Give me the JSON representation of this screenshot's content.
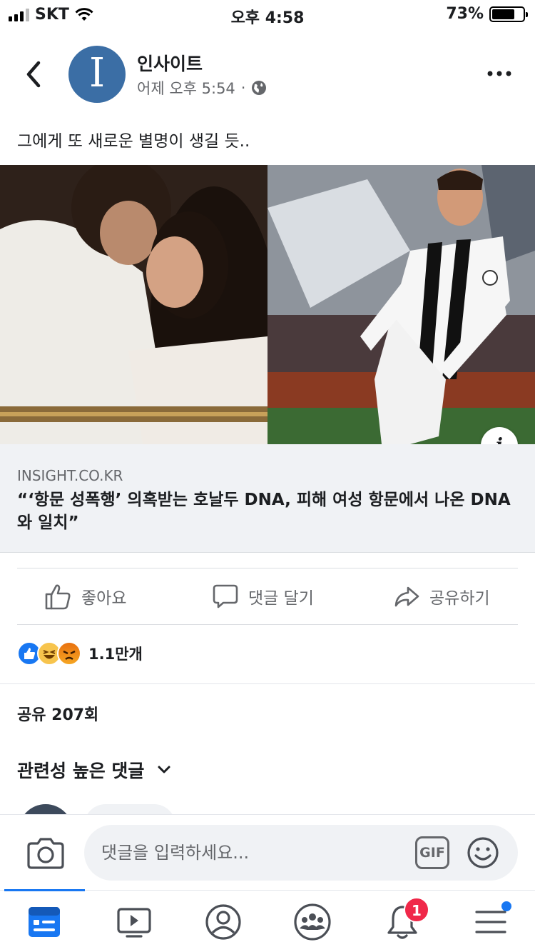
{
  "status_bar": {
    "carrier": "SKT",
    "time": "오후 4:58",
    "battery_percent": "73%",
    "battery_level": 0.73
  },
  "header": {
    "page_name": "인사이트",
    "avatar_letter": "I",
    "timestamp": "어제 오후 5:54",
    "separator": "·",
    "privacy_icon": "globe-icon"
  },
  "post": {
    "text": "그에게 또 새로운 별명이 생길 듯.."
  },
  "link": {
    "info_label": "i",
    "domain": "INSIGHT.CO.KR",
    "title": "“‘항문 성폭행’ 의혹받는 호날두 DNA, 피해 여성 항문에서 나온 DNA와 일치”"
  },
  "actions": {
    "like": "좋아요",
    "comment": "댓글 달기",
    "share": "공유하기"
  },
  "reactions": {
    "types": [
      "like",
      "haha",
      "angry"
    ],
    "count": "1.1만개"
  },
  "shares": {
    "label": "공유 207회"
  },
  "comments": {
    "filter_label": "관련성 높은 댓글"
  },
  "composer": {
    "placeholder": "댓글을 입력하세요...",
    "gif_label": "GIF"
  },
  "tabbar": {
    "items": [
      "news-feed",
      "watch",
      "profile",
      "groups",
      "notifications",
      "menu"
    ],
    "active": "news-feed",
    "notification_badge": "1"
  },
  "colors": {
    "brand_blue": "#1877f2",
    "page_avatar": "#3b6ea5",
    "badge_red": "#f02849"
  }
}
